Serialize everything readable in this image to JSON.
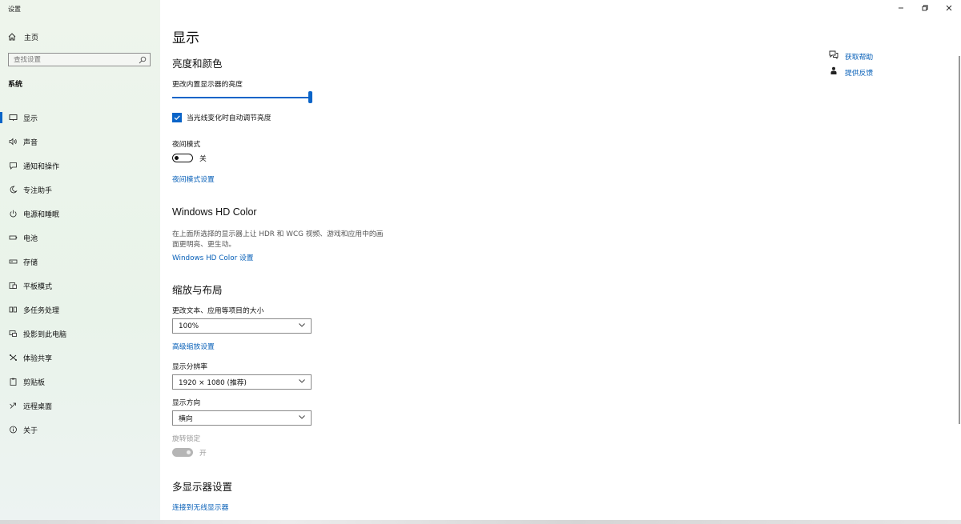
{
  "window": {
    "title": "设置",
    "controls": [
      "minimize-icon",
      "restore-icon",
      "close-icon"
    ]
  },
  "sidebar": {
    "home_label": "主页",
    "search_placeholder": "查找设置",
    "section": "系统",
    "items": [
      {
        "label": "显示",
        "icon": "monitor-icon",
        "active": true
      },
      {
        "label": "声音",
        "icon": "speaker-icon"
      },
      {
        "label": "通知和操作",
        "icon": "notification-icon"
      },
      {
        "label": "专注助手",
        "icon": "moon-icon"
      },
      {
        "label": "电源和睡眠",
        "icon": "power-icon"
      },
      {
        "label": "电池",
        "icon": "battery-icon"
      },
      {
        "label": "存储",
        "icon": "storage-icon"
      },
      {
        "label": "平板模式",
        "icon": "tablet-icon"
      },
      {
        "label": "多任务处理",
        "icon": "multitask-icon"
      },
      {
        "label": "投影到此电脑",
        "icon": "project-icon"
      },
      {
        "label": "体验共享",
        "icon": "share-icon"
      },
      {
        "label": "剪贴板",
        "icon": "clipboard-icon"
      },
      {
        "label": "远程桌面",
        "icon": "remote-desktop-icon"
      },
      {
        "label": "关于",
        "icon": "info-icon"
      }
    ]
  },
  "main": {
    "title": "显示",
    "brightness": {
      "heading": "亮度和颜色",
      "slider_label": "更改内置显示器的亮度",
      "slider_value": 1.0,
      "auto_label": "当光线变化时自动调节亮度",
      "auto_checked": true,
      "night_label": "夜间模式",
      "night_state": "关",
      "night_link": "夜间模式设置"
    },
    "hdr": {
      "heading": "Windows HD Color",
      "desc_line1": "在上面所选择的显示器上让 HDR 和 WCG 视频、游戏和应用中的画",
      "desc_line2": "面更明亮、更生动。",
      "link": "Windows HD Color 设置"
    },
    "scale": {
      "heading": "缩放与布局",
      "scale_label": "更改文本、应用等项目的大小",
      "scale_value": "100%",
      "advanced_link": "高级缩放设置",
      "resolution_label": "显示分辨率",
      "resolution_value": "1920 × 1080 (推荐)",
      "orientation_label": "显示方向",
      "orientation_value": "横向",
      "rotation_lock_label": "旋转锁定",
      "rotation_lock_state": "开"
    },
    "multi": {
      "heading": "多显示器设置",
      "wireless_link": "连接到无线显示器"
    }
  },
  "help": {
    "get_help": "获取帮助",
    "feedback": "提供反馈"
  },
  "colors": {
    "accent": "#0a64c8",
    "link": "#0860b8",
    "sidebar_bg": "#eaf3ea"
  }
}
